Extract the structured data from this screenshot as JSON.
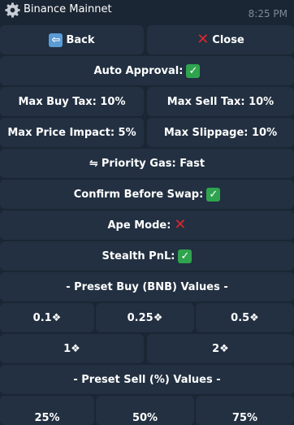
{
  "header": {
    "title": "Binance Mainnet",
    "time": "8:25 PM",
    "icon": "gear-icon"
  },
  "buttons": {
    "back": "Back",
    "close": "Close",
    "auto_approval": "Auto Approval:",
    "max_buy_tax": "Max Buy Tax: 10%",
    "max_sell_tax": "Max Sell Tax: 10%",
    "max_price_impact": "Max Price Impact: 5%",
    "max_slippage": "Max Slippage: 10%",
    "priority_gas": "Priority Gas: Fast",
    "confirm_before_swap": "Confirm Before Swap:",
    "ape_mode": "Ape Mode:",
    "stealth_pnl": "Stealth PnL:",
    "preset_buy_header": "- Preset Buy (BNB) Values -",
    "buy_values": [
      "0.1❖",
      "0.25❖",
      "0.5❖",
      "1❖",
      "2❖"
    ],
    "preset_sell_header": "- Preset Sell (%) Values -",
    "sell_values": [
      "25%",
      "50%",
      "75%"
    ]
  },
  "glyphs": {
    "back_arrow": "⇦",
    "check": "✓",
    "cross": "✕",
    "swap_arrows": "⇋"
  },
  "colors": {
    "background": "#1b2634",
    "button": "#223041",
    "check_green": "#2fa44f",
    "cross_red": "#e0252b",
    "back_blue": "#5b9bd5"
  }
}
